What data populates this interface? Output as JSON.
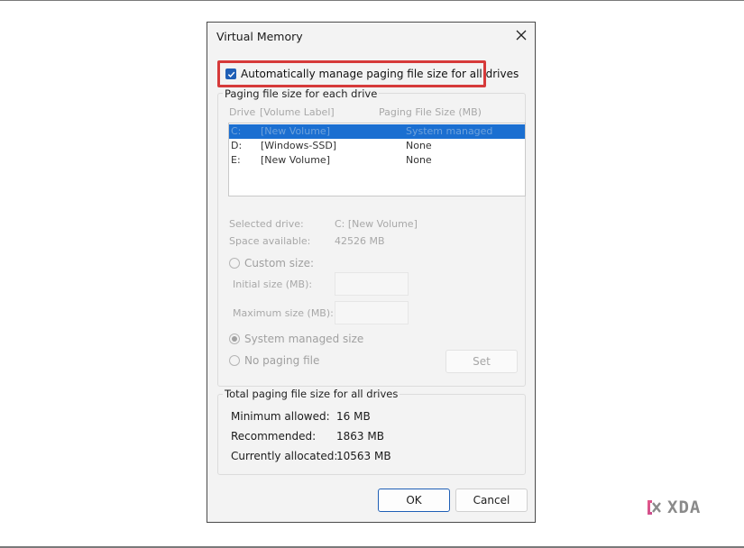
{
  "dialog": {
    "title": "Virtual Memory",
    "auto_manage_label": "Automatically manage paging file size for all drives",
    "auto_manage_checked": true
  },
  "paging_group": {
    "title": "Paging file size for each drive",
    "col_drive": "Drive",
    "col_volume": "[Volume Label]",
    "col_size": "Paging File Size (MB)",
    "drives": [
      {
        "drive": "C:",
        "label": "[New Volume]",
        "size": "System managed",
        "selected": true
      },
      {
        "drive": "D:",
        "label": "[Windows-SSD]",
        "size": "None",
        "selected": false
      },
      {
        "drive": "E:",
        "label": "[New Volume]",
        "size": "None",
        "selected": false
      }
    ],
    "selected_drive_label": "Selected drive:",
    "selected_drive_value": "C:  [New Volume]",
    "space_label": "Space available:",
    "space_value": "42526 MB",
    "custom_size_label": "Custom size:",
    "initial_size_label": "Initial size (MB):",
    "maximum_size_label": "Maximum size (MB):",
    "system_managed_label": "System managed size",
    "no_paging_label": "No paging file",
    "set_label": "Set"
  },
  "totals_group": {
    "title": "Total paging file size for all drives",
    "min_label": "Minimum allowed:",
    "min_value": "16 MB",
    "rec_label": "Recommended:",
    "rec_value": "1863 MB",
    "cur_label": "Currently allocated:",
    "cur_value": "10563 MB"
  },
  "buttons": {
    "ok": "OK",
    "cancel": "Cancel"
  },
  "watermark": {
    "text": "XDA",
    "icon": "xda-logo-icon"
  },
  "colors": {
    "accent": "#1f5fb6",
    "highlight": "#d63a3a",
    "selection": "#1b6fd1"
  }
}
